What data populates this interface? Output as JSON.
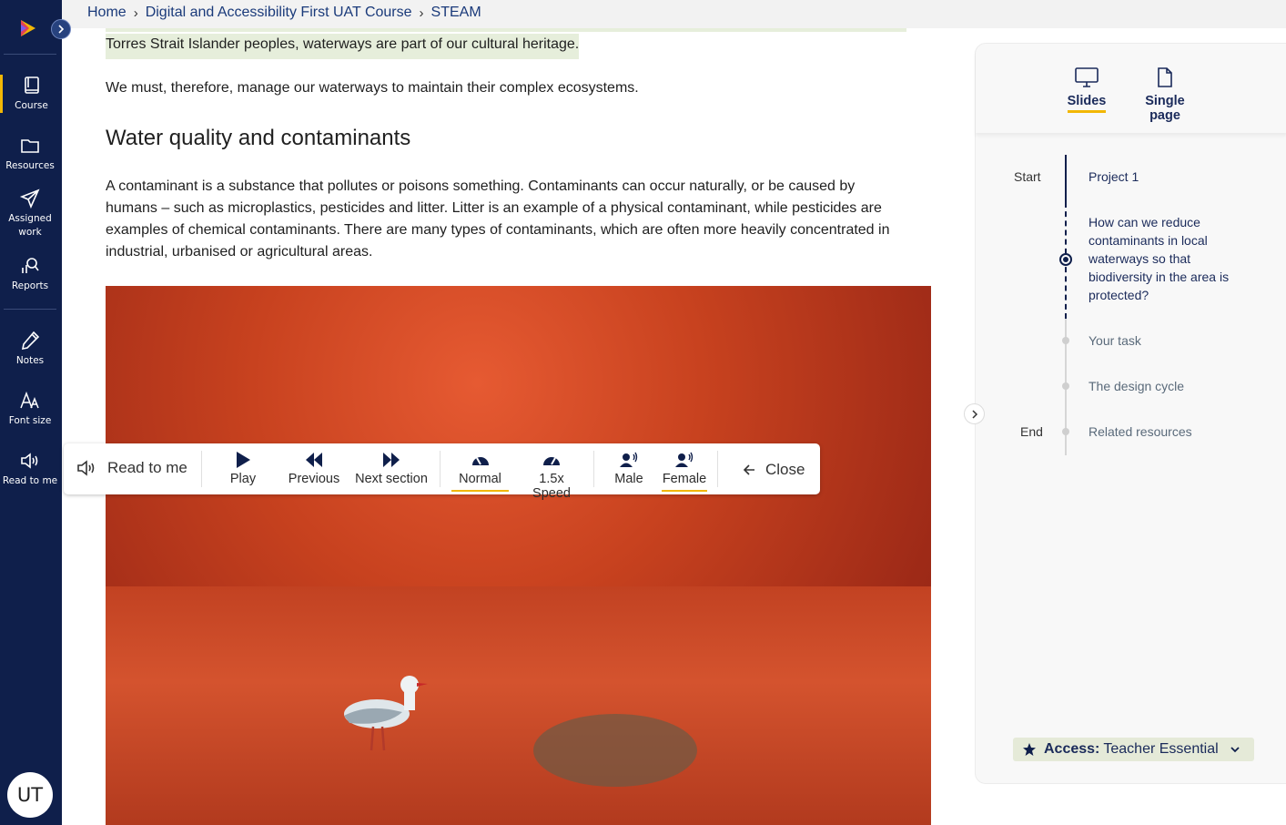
{
  "colors": {
    "nav_bg": "#0f1f4b",
    "accent": "#f2b705",
    "highlight": "#e6eedb",
    "access_bg": "#e5ead8"
  },
  "breadcrumb": [
    "Home",
    "Digital and Accessibility First UAT Course",
    "STEAM"
  ],
  "sidenav": {
    "items": [
      {
        "label": "Course",
        "icon": "book-icon",
        "active": true
      },
      {
        "label": "Resources",
        "icon": "folder-icon"
      },
      {
        "label_lines": [
          "Assigned",
          "work"
        ],
        "icon": "send-icon"
      },
      {
        "label": "Reports",
        "icon": "reports-search-icon"
      },
      {
        "label": "Notes",
        "icon": "pencil-icon"
      },
      {
        "label": "Font size",
        "icon": "font-size-icon"
      },
      {
        "label": "Read to me",
        "icon": "speaker-icon"
      }
    ],
    "avatar_initials": "UT"
  },
  "content": {
    "highlight_line": "Torres Strait Islander peoples, waterways are part of our cultural heritage.",
    "para1": "We must, therefore, manage our waterways to maintain their complex ecosystems.",
    "heading": "Water quality and contaminants",
    "para2_lines": [
      "A contaminant is a substance that pollutes or poisons something. Contaminants can occur naturally, or be caused by",
      "humans – such as microplastics, pesticides and litter. Litter is an example of a physical contaminant, while pesticides are",
      "examples of chemical contaminants. There are many types of contaminants, which are often more heavily concentrated in",
      "industrial, urbanised or agricultural areas."
    ]
  },
  "read_to_me": {
    "title": "Read to me",
    "buttons": [
      "Play",
      "Previous",
      "Next section",
      "Normal",
      "1.5x Speed",
      "Male",
      "Female"
    ],
    "selected": [
      "Normal",
      "Female"
    ],
    "close": "Close"
  },
  "right_panel": {
    "tabs": [
      "Slides",
      "Single page"
    ],
    "selected_tab": "Slides",
    "start_label": "Start",
    "end_label": "End",
    "timeline": [
      "Project 1",
      "How can we reduce contaminants in local waterways so that biodiversity in the area is protected?",
      "Your task",
      "The design cycle",
      "Related resources"
    ],
    "access_key": "Access:",
    "access_value": "Teacher Essential"
  }
}
